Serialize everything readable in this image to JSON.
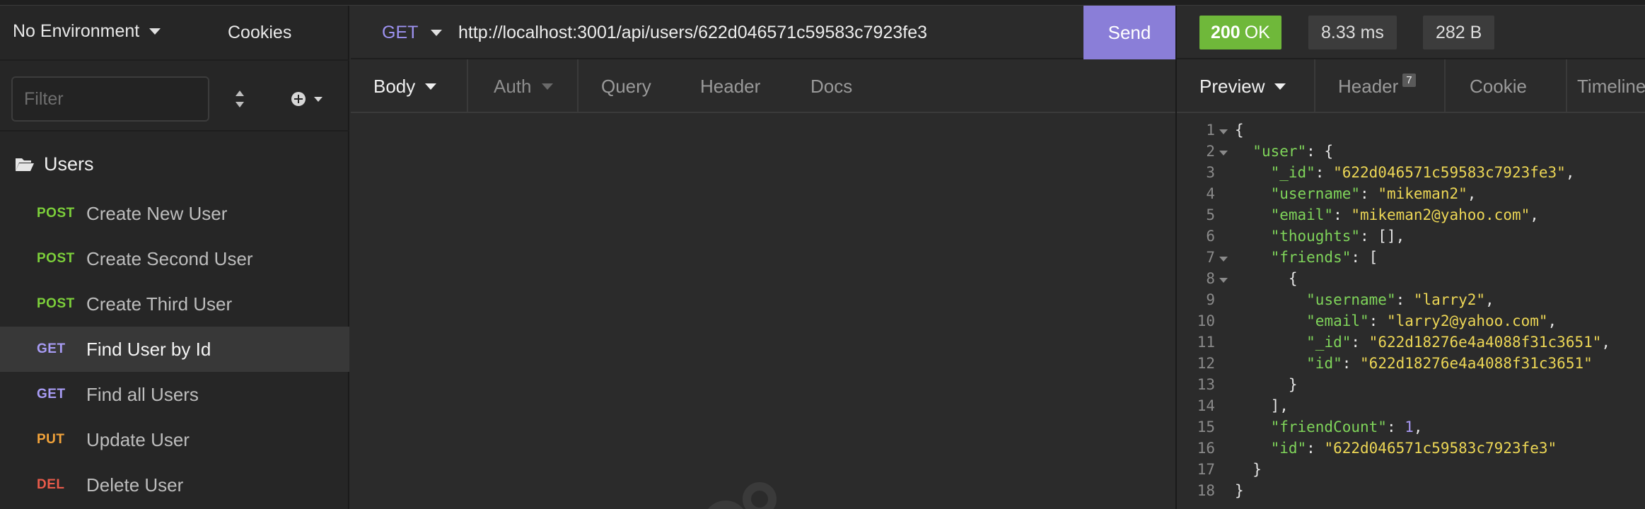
{
  "sidebar": {
    "environment": "No Environment",
    "cookies": "Cookies",
    "filter_placeholder": "Filter",
    "folder": "Users",
    "requests": [
      {
        "method": "POST",
        "name": "Create New User"
      },
      {
        "method": "POST",
        "name": "Create Second User"
      },
      {
        "method": "POST",
        "name": "Create Third User"
      },
      {
        "method": "GET",
        "name": "Find User by Id"
      },
      {
        "method": "GET",
        "name": "Find all Users"
      },
      {
        "method": "PUT",
        "name": "Update User"
      },
      {
        "method": "DEL",
        "name": "Delete User"
      }
    ]
  },
  "request": {
    "method": "GET",
    "url": "http://localhost:3001/api/users/622d046571c59583c7923fe3",
    "send_label": "Send",
    "tabs": {
      "body": "Body",
      "auth": "Auth",
      "query": "Query",
      "header": "Header",
      "docs": "Docs"
    }
  },
  "response": {
    "status_code": "200",
    "status_text": "OK",
    "time": "8.33 ms",
    "size": "282 B",
    "tabs": {
      "preview": "Preview",
      "header": "Header",
      "header_count": "7",
      "cookie": "Cookie",
      "timeline": "Timeline"
    },
    "lines": [
      "{",
      "  \"user\": {",
      "    \"_id\": \"622d046571c59583c7923fe3\",",
      "    \"username\": \"mikeman2\",",
      "    \"email\": \"mikeman2@yahoo.com\",",
      "    \"thoughts\": [],",
      "    \"friends\": [",
      "      {",
      "        \"username\": \"larry2\",",
      "        \"email\": \"larry2@yahoo.com\",",
      "        \"_id\": \"622d18276e4a4088f31c3651\",",
      "        \"id\": \"622d18276e4a4088f31c3651\"",
      "      }",
      "    ],",
      "    \"friendCount\": 1,",
      "    \"id\": \"622d046571c59583c7923fe3\"",
      "  }",
      "}"
    ]
  },
  "colors": {
    "accent": "#8a7ed8",
    "status_ok": "#6fb83a",
    "post": "#7ccf3a",
    "get": "#a89cf5",
    "put": "#f2a33a",
    "del": "#e85a4a"
  }
}
